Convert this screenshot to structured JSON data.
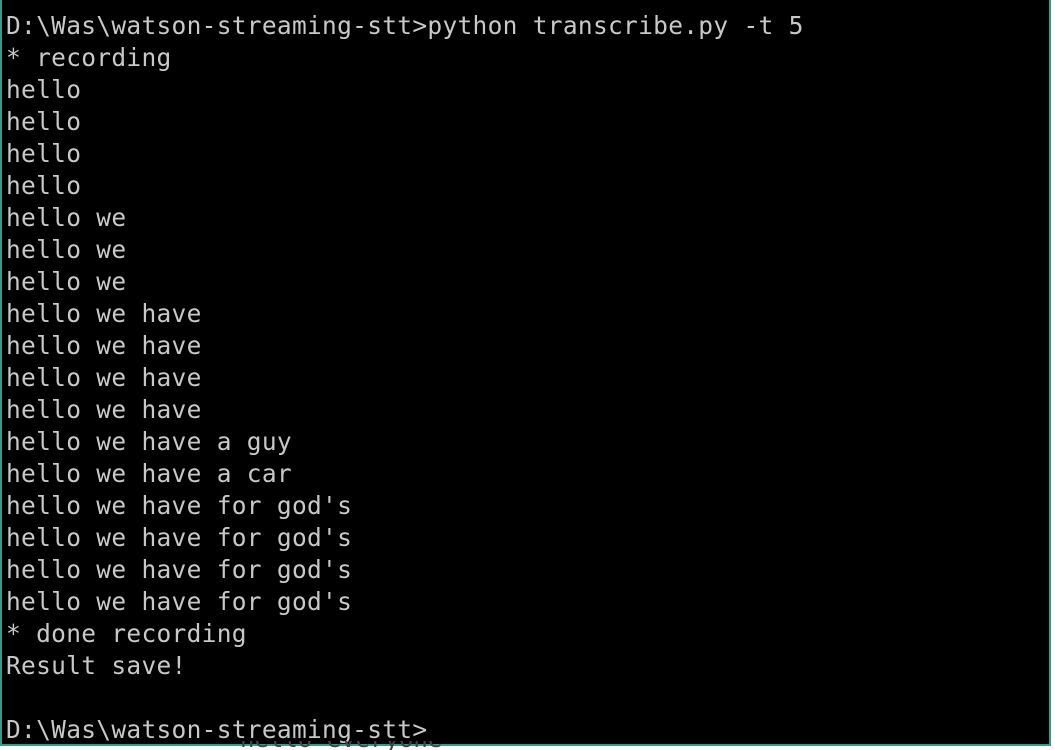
{
  "console": {
    "lines": [
      "D:\\Was\\watson-streaming-stt>python transcribe.py -t 5",
      "* recording",
      "hello",
      "hello",
      "hello",
      "hello",
      "hello we",
      "hello we",
      "hello we",
      "hello we have",
      "hello we have",
      "hello we have",
      "hello we have",
      "hello we have a guy",
      "hello we have a car",
      "hello we have for god's",
      "hello we have for god's",
      "hello we have for god's",
      "hello we have for god's",
      "* done recording",
      "Result save!",
      ""
    ],
    "prompt": "D:\\Was\\watson-streaming-stt>",
    "input_value": ""
  },
  "colors": {
    "background": "#000000",
    "text": "#c8c8c8",
    "frame": "#2e9e8a"
  },
  "background_fragment": "hello everyone"
}
